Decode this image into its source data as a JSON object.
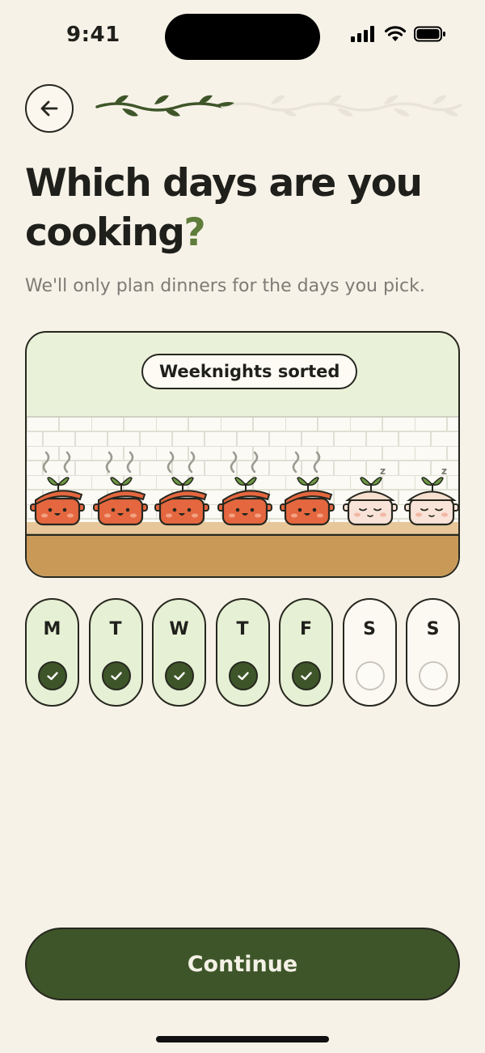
{
  "status_bar": {
    "time": "9:41"
  },
  "header": {
    "back_icon": "arrow-left-icon",
    "progress_steps_total": 6,
    "progress_steps_done": 3
  },
  "title": {
    "main": "Which days are you cooking",
    "accent": "?"
  },
  "subtitle": "We'll only plan dinners for the days you pick.",
  "illustration": {
    "badge": "Weeknights sorted",
    "pots": [
      {
        "state": "cooking"
      },
      {
        "state": "cooking"
      },
      {
        "state": "cooking"
      },
      {
        "state": "cooking"
      },
      {
        "state": "cooking"
      },
      {
        "state": "sleeping"
      },
      {
        "state": "sleeping"
      }
    ]
  },
  "days": [
    {
      "letter": "M",
      "selected": true
    },
    {
      "letter": "T",
      "selected": true
    },
    {
      "letter": "W",
      "selected": true
    },
    {
      "letter": "T",
      "selected": true
    },
    {
      "letter": "F",
      "selected": true
    },
    {
      "letter": "S",
      "selected": false
    },
    {
      "letter": "S",
      "selected": false
    }
  ],
  "continue_label": "Continue",
  "colors": {
    "background": "#f7f2e8",
    "primary": "#3e5529",
    "accent_green": "#5f7d3a",
    "pot_orange": "#e5673f",
    "selected_fill": "#e6f0d4"
  }
}
